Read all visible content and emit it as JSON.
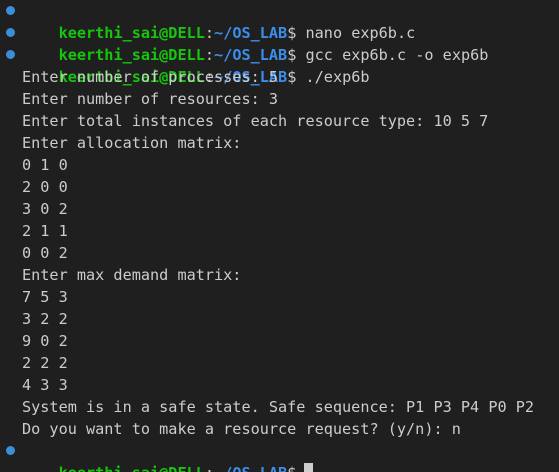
{
  "prompt": {
    "user_host": "keerthi_sai@DELL",
    "sep": ":",
    "path": "~/OS_LAB",
    "dollar": "$"
  },
  "commands": [
    "nano exp6b.c",
    "gcc exp6b.c -o exp6b",
    "./exp6b"
  ],
  "output_lines": [
    "Enter number of processes: 5",
    "Enter number of resources: 3",
    "Enter total instances of each resource type: 10 5 7",
    "Enter allocation matrix:",
    "0 1 0",
    "2 0 0",
    "3 0 2",
    "2 1 1",
    "0 0 2",
    "Enter max demand matrix:",
    "7 5 3",
    "3 2 2",
    "9 0 2",
    "2 2 2",
    "4 3 3",
    "System is in a safe state. Safe sequence: P1 P3 P4 P0 P2",
    "Do you want to make a resource request? (y/n): n"
  ],
  "colors": {
    "background": "#1f1f1f",
    "user_host": "#16c60c",
    "path": "#3b8eea",
    "text": "#cccccc",
    "prompt_dot": "#3a8fd6"
  }
}
